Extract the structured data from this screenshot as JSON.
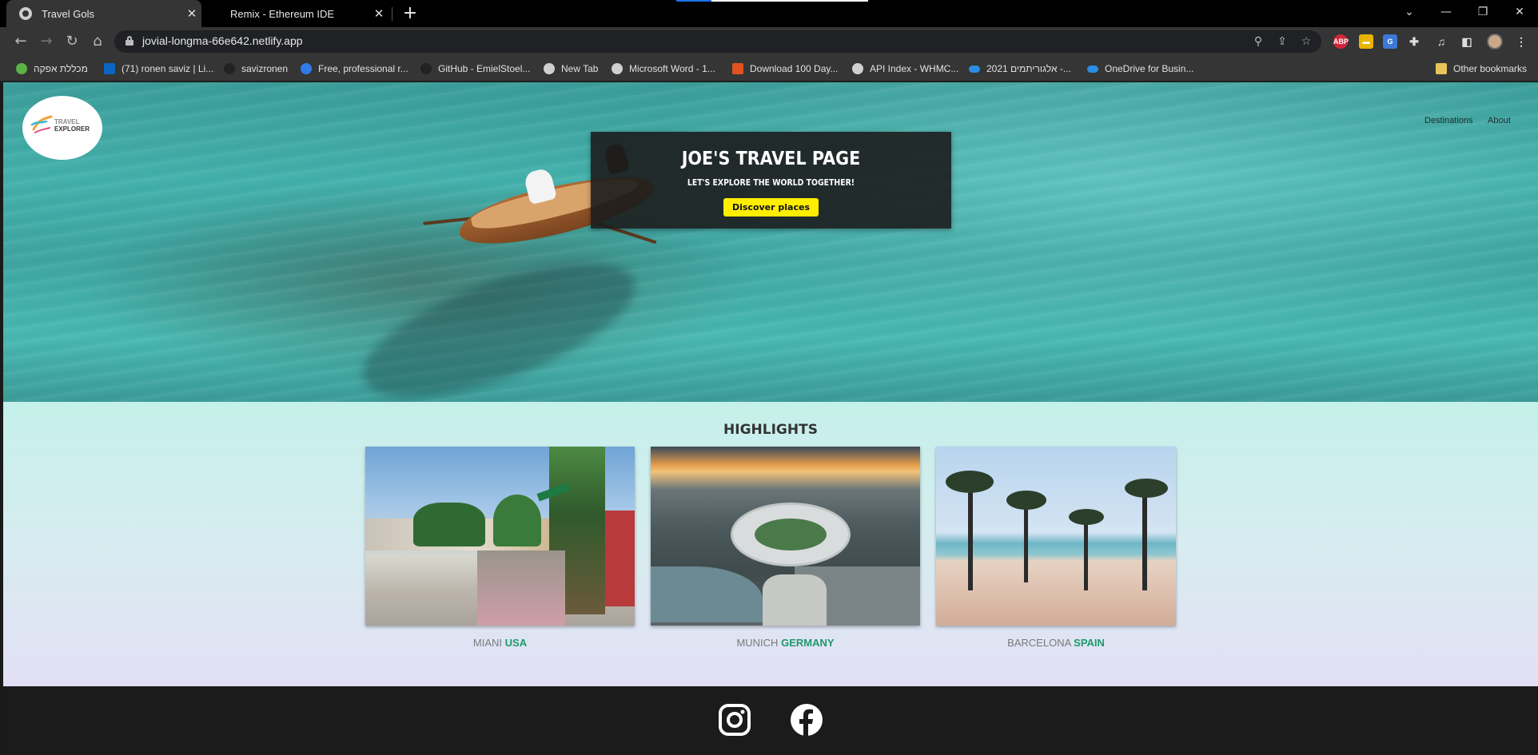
{
  "browser": {
    "tabs": [
      {
        "title": "Travel Gols",
        "active": true
      },
      {
        "title": "Remix - Ethereum IDE",
        "active": false
      }
    ],
    "url": "jovial-longma-66e642.netlify.app",
    "bookmarks": [
      {
        "label": "מכללת אפקה",
        "icon": "leaf-icon",
        "color": "#5bb346"
      },
      {
        "label": "(71) ronen saviz | Li...",
        "icon": "linkedin-icon",
        "color": "#0a66c2"
      },
      {
        "label": "savizronen",
        "icon": "github-icon",
        "color": "#222222"
      },
      {
        "label": "Free, professional r...",
        "icon": "c-icon",
        "color": "#2f7bea"
      },
      {
        "label": "GitHub - EmielStoel...",
        "icon": "github-icon",
        "color": "#222222"
      },
      {
        "label": "New Tab",
        "icon": "globe-icon",
        "color": "#d0d0d0"
      },
      {
        "label": "Microsoft Word - 1...",
        "icon": "globe-icon",
        "color": "#d0d0d0"
      },
      {
        "label": "Download 100 Day...",
        "icon": "x-icon",
        "color": "#e0531f"
      },
      {
        "label": "API Index - WHMC...",
        "icon": "globe-icon",
        "color": "#d0d0d0"
      },
      {
        "label": "אלגוריתמים 2021 -...",
        "icon": "onedrive-icon",
        "color": "#2b8de3"
      },
      {
        "label": "OneDrive for Busin...",
        "icon": "onedrive-icon",
        "color": "#2b8de3"
      }
    ],
    "other_bookmarks": "Other bookmarks"
  },
  "site": {
    "logo": {
      "line1": "TRAVEL",
      "line2": "EXPLORER"
    },
    "nav": [
      "Destinations",
      "About"
    ],
    "hero": {
      "title": "JOE'S TRAVEL PAGE",
      "subtitle": "LET'S EXPLORE THE WORLD TOGETHER!",
      "button": "Discover places",
      "button_color": "#ffee00"
    },
    "highlights": {
      "title": "HIGHLIGHTS",
      "cards": [
        {
          "city": "MIANI",
          "country": "USA"
        },
        {
          "city": "MUNICH",
          "country": "GERMANY"
        },
        {
          "city": "BARCELONA",
          "country": "SPAIN"
        }
      ],
      "country_color": "#1d9a6b"
    },
    "footer": {
      "icons": [
        "instagram-icon",
        "facebook-icon"
      ]
    }
  }
}
